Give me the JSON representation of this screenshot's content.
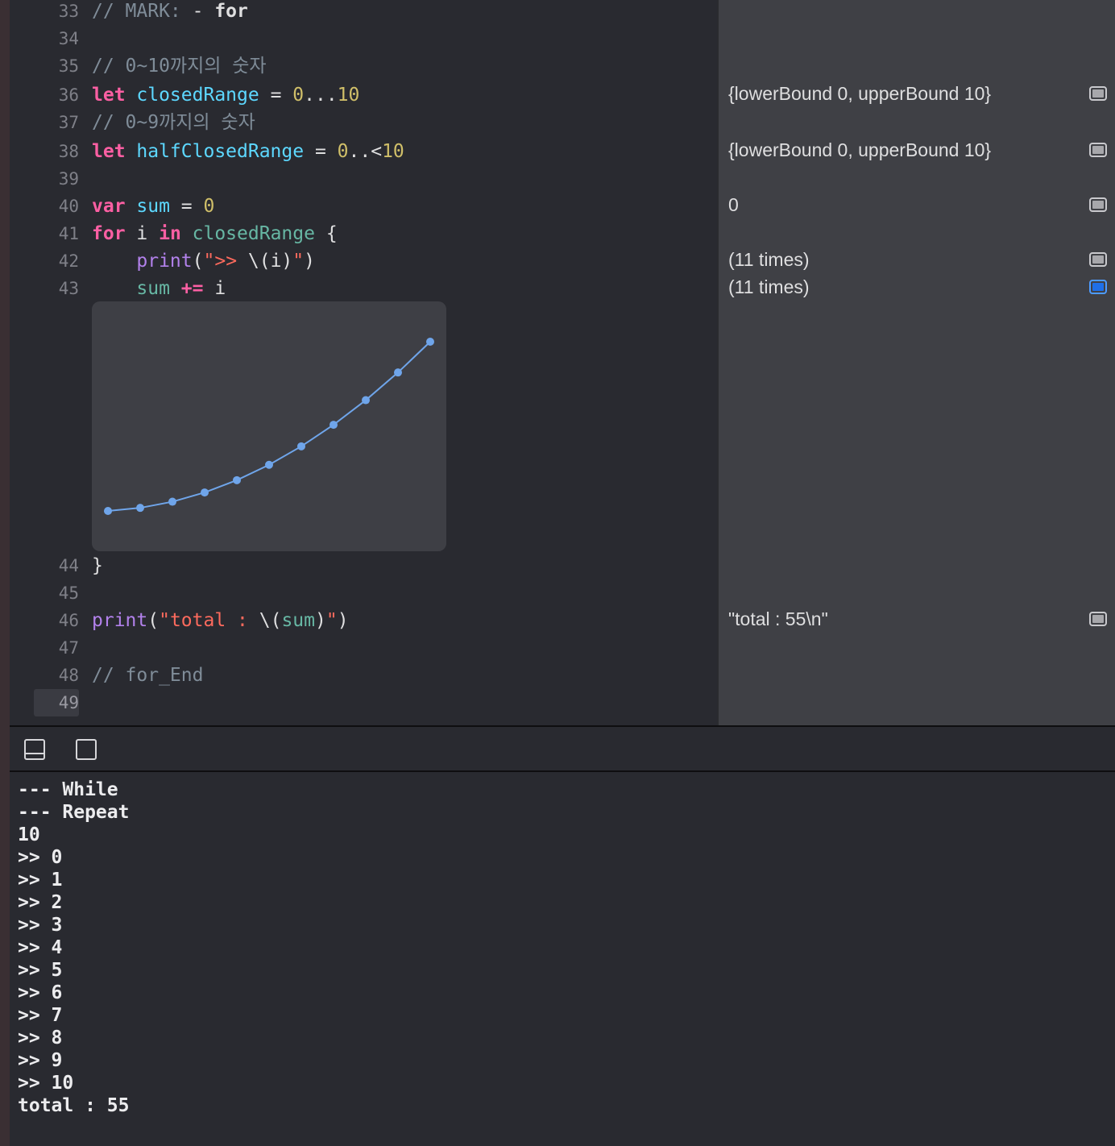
{
  "editor": {
    "lines": [
      {
        "n": "33",
        "tokens": [
          [
            "cmt",
            "// MARK: "
          ],
          [
            "plain",
            "- "
          ],
          [
            "bold",
            "for"
          ]
        ]
      },
      {
        "n": "34",
        "tokens": []
      },
      {
        "n": "35",
        "tokens": [
          [
            "cmt",
            "// 0~10까지의 숫자"
          ]
        ]
      },
      {
        "n": "36",
        "tokens": [
          [
            "kw",
            "let "
          ],
          [
            "id",
            "closedRange"
          ],
          [
            "plain",
            " = "
          ],
          [
            "num",
            "0"
          ],
          [
            "plain",
            "..."
          ],
          [
            "num",
            "10"
          ]
        ]
      },
      {
        "n": "37",
        "tokens": [
          [
            "cmt",
            "// 0~9까지의 숫자"
          ]
        ]
      },
      {
        "n": "38",
        "tokens": [
          [
            "kw",
            "let "
          ],
          [
            "id",
            "halfClosedRange"
          ],
          [
            "plain",
            " = "
          ],
          [
            "num",
            "0"
          ],
          [
            "plain",
            "..<"
          ],
          [
            "num",
            "10"
          ]
        ]
      },
      {
        "n": "39",
        "tokens": []
      },
      {
        "n": "40",
        "tokens": [
          [
            "kw",
            "var "
          ],
          [
            "id",
            "sum"
          ],
          [
            "plain",
            " = "
          ],
          [
            "num",
            "0"
          ]
        ]
      },
      {
        "n": "41",
        "tokens": [
          [
            "kw",
            "for "
          ],
          [
            "plain",
            "i "
          ],
          [
            "kw",
            "in "
          ],
          [
            "teal",
            "closedRange"
          ],
          [
            "plain",
            " {"
          ]
        ]
      },
      {
        "n": "42",
        "tokens": [
          [
            "plain",
            "    "
          ],
          [
            "fn",
            "print"
          ],
          [
            "plain",
            "("
          ],
          [
            "str",
            "\">> "
          ],
          [
            "plain",
            "\\(i)"
          ],
          [
            "str",
            "\""
          ],
          [
            "plain",
            ")"
          ]
        ]
      },
      {
        "n": "43",
        "tokens": [
          [
            "plain",
            "    "
          ],
          [
            "teal",
            "sum"
          ],
          [
            "plain",
            " "
          ],
          [
            "kw",
            "+="
          ],
          [
            "plain",
            " i"
          ]
        ]
      },
      {
        "n": "44",
        "tokens": [
          [
            "plain",
            "}"
          ]
        ]
      },
      {
        "n": "45",
        "tokens": []
      },
      {
        "n": "46",
        "tokens": [
          [
            "fn",
            "print"
          ],
          [
            "plain",
            "("
          ],
          [
            "str",
            "\"total : "
          ],
          [
            "plain",
            "\\("
          ],
          [
            "teal",
            "sum"
          ],
          [
            "plain",
            ")"
          ],
          [
            "str",
            "\""
          ],
          [
            "plain",
            ")"
          ]
        ]
      },
      {
        "n": "47",
        "tokens": []
      },
      {
        "n": "48",
        "tokens": [
          [
            "cmt",
            "// for_End"
          ]
        ]
      },
      {
        "n": "49",
        "tokens": [],
        "current": true
      }
    ]
  },
  "results": [
    {
      "line": "36",
      "text": "{lowerBound 0, upperBound 10}",
      "active": false
    },
    {
      "line": "38",
      "text": "{lowerBound 0, upperBound 10}",
      "active": false
    },
    {
      "line": "40",
      "text": "0",
      "active": false
    },
    {
      "line": "42",
      "text": "(11 times)",
      "active": false
    },
    {
      "line": "43",
      "text": "(11 times)",
      "active": true
    },
    {
      "line": "46",
      "text": "\"total : 55\\n\"",
      "active": false
    }
  ],
  "graph": {
    "values": [
      0,
      1,
      3,
      6,
      10,
      15,
      21,
      28,
      36,
      45,
      55
    ],
    "color": "#6fa5ea"
  },
  "console": {
    "lines": [
      "--- While",
      "--- Repeat",
      "10",
      ">> 0",
      ">> 1",
      ">> 2",
      ">> 3",
      ">> 4",
      ">> 5",
      ">> 6",
      ">> 7",
      ">> 8",
      ">> 9",
      ">> 10",
      "total : 55"
    ]
  },
  "icons": {
    "hide_console": "hide-debug-area-icon",
    "split": "split-view-icon",
    "quick_look": "quick-look-icon"
  },
  "colors": {
    "keyword": "#fc5fa3",
    "function": "#b281eb",
    "string": "#fc6a5d",
    "number": "#d0bf69",
    "comment": "#7f8c98",
    "identifier": "#5dd8ff",
    "accent": "#1f6fe8"
  }
}
